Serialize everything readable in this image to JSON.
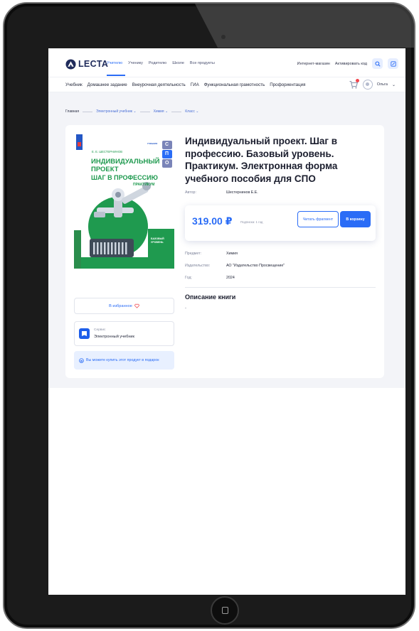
{
  "header": {
    "logo_text": "LECTA",
    "roles": [
      "Учителю",
      "Ученику",
      "Родителю",
      "Школе",
      "Все продукты"
    ],
    "links": [
      "Интернет-магазин",
      "Активировать код"
    ]
  },
  "nav": {
    "items": [
      "Учебник",
      "Домашнее задание",
      "Внеурочная деятельность",
      "ГИА",
      "Функциональная грамотность",
      "Профориентация"
    ],
    "user_name": "Ольга"
  },
  "breadcrumb": [
    "Главная",
    "Электронный учебник ⌄",
    "Химия ⌄",
    "Класс ⌄"
  ],
  "product": {
    "title": "Индивидуальный проект. Шаг в профессию. Базовый уровень. Практикум. Электронная форма учебного пособия для СПО",
    "author_label": "Автор:",
    "author": "Шестернинов Е.Е.",
    "price": "319.00 ₽",
    "subscription": "Подписка: 1 год",
    "read_button": "Читать фрагмент",
    "cart_button": "В корзину",
    "details": [
      {
        "key": "Предмет:",
        "value": "Химия"
      },
      {
        "key": "Издательство:",
        "value": "АО \"Издательство Просвещение\""
      },
      {
        "key": "Год:",
        "value": "2024"
      }
    ],
    "description_title": "Описание книги",
    "description": "-"
  },
  "cover": {
    "author": "Е. Е. ШЕСТЕРНИНОВ",
    "line1": "ИНДИВИДУАЛЬНЫЙ",
    "line2": "ПРОЕКТ",
    "line3": "ШАГ В ПРОФЕССИЮ",
    "line4": "ПРАКТИКУМ",
    "badge": "БАЗОВЫЙ УРОВЕНЬ",
    "series": "УЧЕБНИК",
    "spo_letters": [
      "С",
      "П",
      "О"
    ]
  },
  "sidebar": {
    "favorite": "В избранное",
    "service_caption": "Сервис",
    "service_name": "Электронный учебник",
    "gift": "Вы можете купить этот продукт в подарок"
  },
  "colors": {
    "accent": "#2a6cf6",
    "cover_green": "#1f9a4f",
    "frame": "#1b1b1b"
  }
}
